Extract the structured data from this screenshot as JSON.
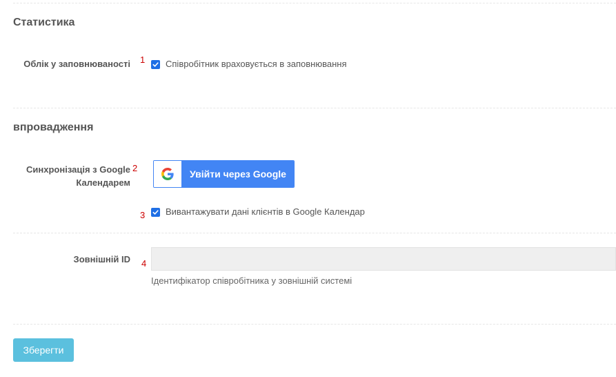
{
  "statistics": {
    "title": "Статистика",
    "occupancy_label": "Облік у заповнюваності",
    "occupancy_marker": "1",
    "occupancy_checked": true,
    "occupancy_text": "Співробітник враховується в заповнювання"
  },
  "integration": {
    "title": "впровадження",
    "google_sync_label": "Синхронізація з Google Календарем",
    "google_sync_marker": "2",
    "google_button_label": "Увійти через Google",
    "export_marker": "3",
    "export_checked": true,
    "export_text": "Вивантажувати дані клієнтів в Google Календар"
  },
  "external_id": {
    "label": "Зовнішній ID",
    "marker": "4",
    "value": "",
    "help": "Ідентифікатор співробітника у зовнішній системі"
  },
  "save_label": "Зберегти",
  "colors": {
    "checkbox": "#1f6fe5",
    "google_blue": "#4285f4",
    "save_button": "#5bc0de",
    "marker": "#cc0000"
  }
}
